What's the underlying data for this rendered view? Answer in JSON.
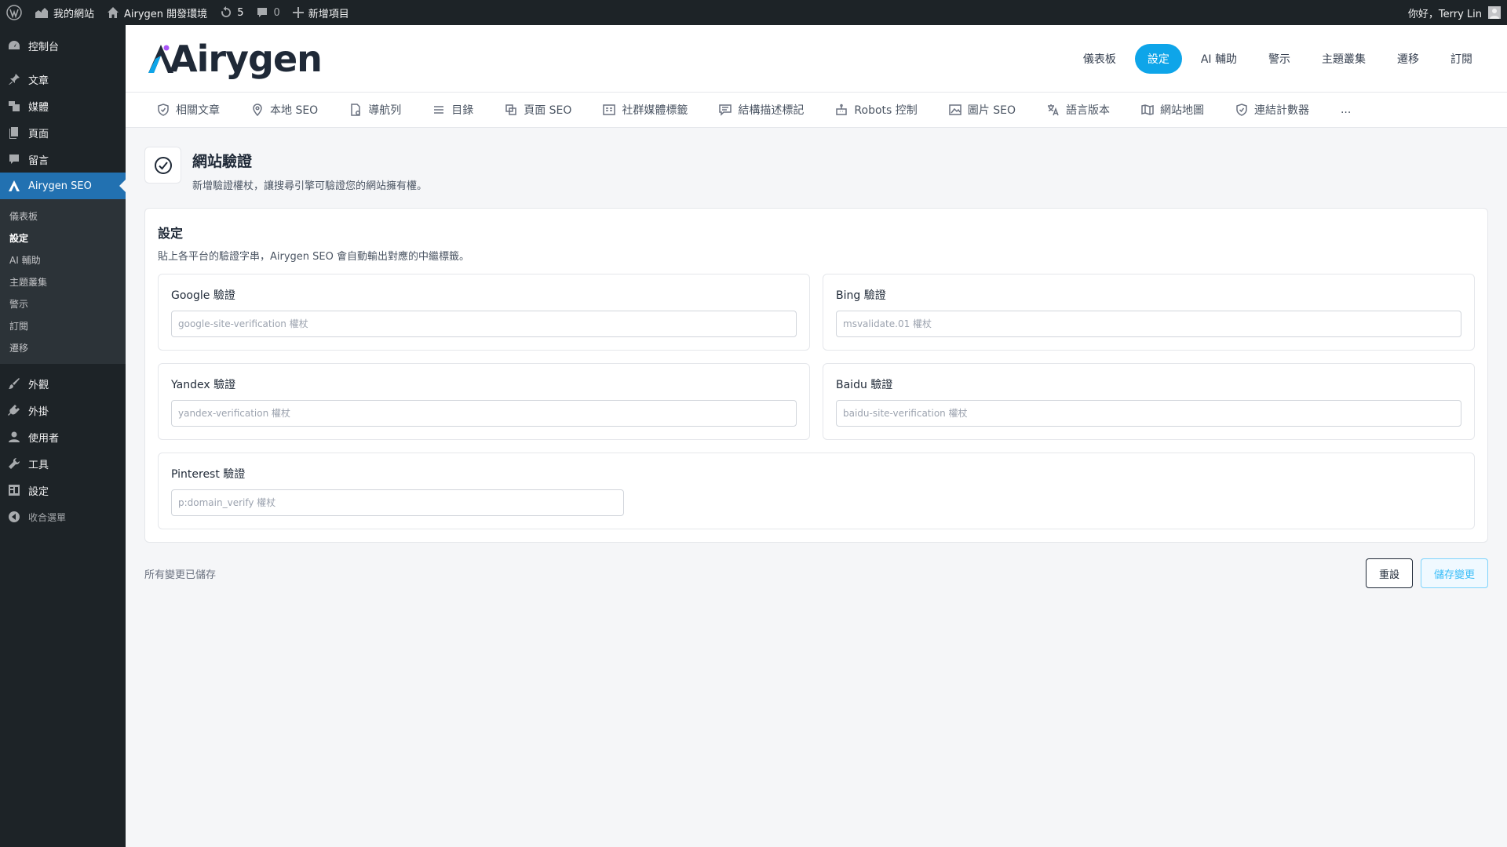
{
  "adminbar": {
    "site_name": "我的網站",
    "env_name": "Airygen 開發環境",
    "updates_count": "5",
    "comments_count": "0",
    "new_item": "新增項目",
    "greeting": "你好，Terry Lin"
  },
  "sidebar": {
    "dashboard": "控制台",
    "posts": "文章",
    "media": "媒體",
    "pages": "頁面",
    "comments": "留言",
    "plugin": "Airygen SEO",
    "submenu": [
      "儀表板",
      "設定",
      "AI 輔助",
      "主題叢集",
      "警示",
      "訂閱",
      "遷移"
    ],
    "appearance": "外觀",
    "plugins": "外掛",
    "users": "使用者",
    "tools": "工具",
    "settings": "設定",
    "collapse": "收合選單"
  },
  "header": {
    "logo": "Airygen",
    "nav": [
      "儀表板",
      "設定",
      "AI 輔助",
      "警示",
      "主題叢集",
      "遷移",
      "訂閱"
    ]
  },
  "tabs": [
    "相關文章",
    "本地 SEO",
    "導航列",
    "目錄",
    "頁面 SEO",
    "社群媒體標籤",
    "結構描述標記",
    "Robots 控制",
    "圖片 SEO",
    "語言版本",
    "網站地圖",
    "連結計數器",
    "..."
  ],
  "page": {
    "title": "網站驗證",
    "subtitle": "新增驗證權杖，讓搜尋引擎可驗證您的網站擁有權。"
  },
  "card": {
    "title": "設定",
    "description": "貼上各平台的驗證字串，Airygen SEO 會自動輸出對應的中繼標籤。",
    "fields": {
      "google": {
        "label": "Google 驗證",
        "placeholder": "google-site-verification 權杖"
      },
      "bing": {
        "label": "Bing 驗證",
        "placeholder": "msvalidate.01 權杖"
      },
      "yandex": {
        "label": "Yandex 驗證",
        "placeholder": "yandex-verification 權杖"
      },
      "baidu": {
        "label": "Baidu 驗證",
        "placeholder": "baidu-site-verification 權杖"
      },
      "pinterest": {
        "label": "Pinterest 驗證",
        "placeholder": "p:domain_verify 權杖"
      }
    }
  },
  "footer": {
    "status": "所有變更已儲存",
    "reset": "重設",
    "save": "儲存變更"
  },
  "colors": {
    "accent": "#0ea5e9",
    "admin_bg": "#1d2327",
    "wp_blue": "#2271b1"
  }
}
